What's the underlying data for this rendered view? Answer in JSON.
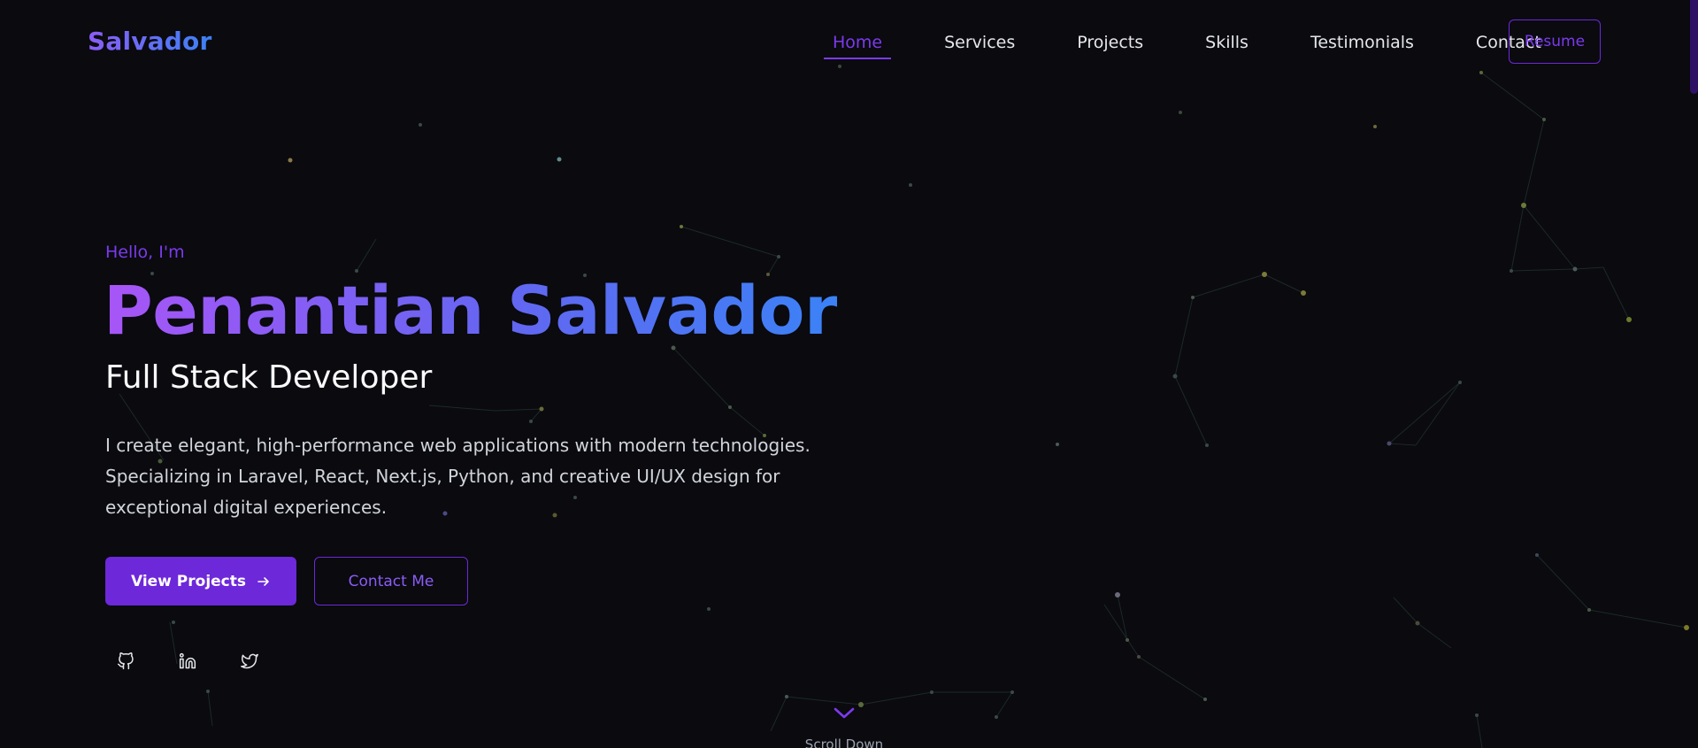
{
  "brand": {
    "name": "Salvador"
  },
  "nav": {
    "items": [
      {
        "label": "Home",
        "active": true
      },
      {
        "label": "Services",
        "active": false
      },
      {
        "label": "Projects",
        "active": false
      },
      {
        "label": "Skills",
        "active": false
      },
      {
        "label": "Testimonials",
        "active": false
      },
      {
        "label": "Contact",
        "active": false
      }
    ],
    "resume_label": "Resume"
  },
  "hero": {
    "greeting": "Hello, I'm",
    "name": "Penantian Salvador",
    "role": "Full Stack Developer",
    "description": "I create elegant, high-performance web applications with modern technologies. Specializing in Laravel, React, Next.js, Python, and creative UI/UX design for exceptional digital experiences.",
    "primary_button": "View Projects",
    "secondary_button": "Contact Me"
  },
  "socials": [
    {
      "icon": "github-icon"
    },
    {
      "icon": "linkedin-icon"
    },
    {
      "icon": "twitter-icon"
    }
  ],
  "scroll": {
    "label": "Scroll Down",
    "icon": "chevron-down-icon"
  },
  "colors": {
    "background": "#0a0a0f",
    "accent": "#6d28d9",
    "accent_light": "#7c3aed",
    "gradient_start": "#a855f7",
    "gradient_end": "#3b82f6"
  }
}
